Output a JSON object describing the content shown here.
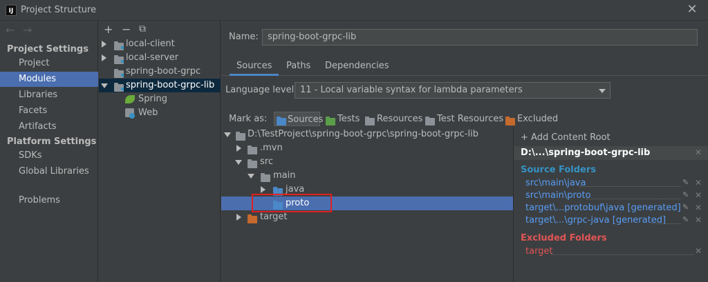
{
  "window": {
    "app_icon": "IJ",
    "title": "Project Structure",
    "close": "✕"
  },
  "nav": {
    "back": "←",
    "forward": "→",
    "project_settings_header": "Project Settings",
    "platform_settings_header": "Platform Settings",
    "items": [
      "Project",
      "Modules",
      "Libraries",
      "Facets",
      "Artifacts",
      "SDKs",
      "Global Libraries",
      "Problems"
    ],
    "selected": "Modules"
  },
  "modules_toolbar": {
    "add": "+",
    "remove": "−",
    "copy": "⧉"
  },
  "modules": [
    {
      "label": "local-client",
      "expanded": false
    },
    {
      "label": "local-server",
      "expanded": false
    },
    {
      "label": "spring-boot-grpc",
      "expanded": false
    },
    {
      "label": "spring-boot-grpc-lib",
      "expanded": true,
      "selected": true
    }
  ],
  "facets": [
    "Spring",
    "Web"
  ],
  "name_field": {
    "label": "Name:",
    "value": "spring-boot-grpc-lib"
  },
  "tabs": [
    "Sources",
    "Paths",
    "Dependencies"
  ],
  "active_tab": "Sources",
  "language_level": {
    "label": "Language level:",
    "value": "11 - Local variable syntax for lambda parameters"
  },
  "mark_as": {
    "label": "Mark as:",
    "buttons": [
      "Sources",
      "Tests",
      "Resources",
      "Test Resources",
      "Excluded"
    ],
    "selected": "Sources"
  },
  "tree": [
    {
      "label": "D:\\TestProject\\spring-boot-grpc\\spring-boot-grpc-lib",
      "depth": 0,
      "expanded": true,
      "icon": "folder-gray"
    },
    {
      "label": ".mvn",
      "depth": 1,
      "expanded": false,
      "icon": "folder-gray"
    },
    {
      "label": "src",
      "depth": 1,
      "expanded": true,
      "icon": "folder-gray"
    },
    {
      "label": "main",
      "depth": 2,
      "expanded": true,
      "icon": "folder-gray"
    },
    {
      "label": "java",
      "depth": 3,
      "expanded": false,
      "icon": "folder-blue"
    },
    {
      "label": "proto",
      "depth": 3,
      "expanded": false,
      "icon": "folder-blue",
      "selected": true
    },
    {
      "label": "target",
      "depth": 1,
      "expanded": false,
      "icon": "folder-orange"
    }
  ],
  "content_root": {
    "add_label": "+ Add Content Root",
    "root": "D:\\...\\spring-boot-grpc-lib",
    "source_header": "Source Folders",
    "source_folders": [
      "src\\main\\java",
      "src\\main\\proto",
      "target\\...protobuf\\java [generated]",
      "target\\...\\grpc-java [generated]"
    ],
    "excluded_header": "Excluded Folders",
    "excluded_folders": [
      "target"
    ]
  },
  "colors": {
    "accent": "#4b6eaf",
    "source_link": "#589df6",
    "excluded_header": "#e05555",
    "source_header": "#3592c4",
    "highlight_box": "#e02020"
  }
}
